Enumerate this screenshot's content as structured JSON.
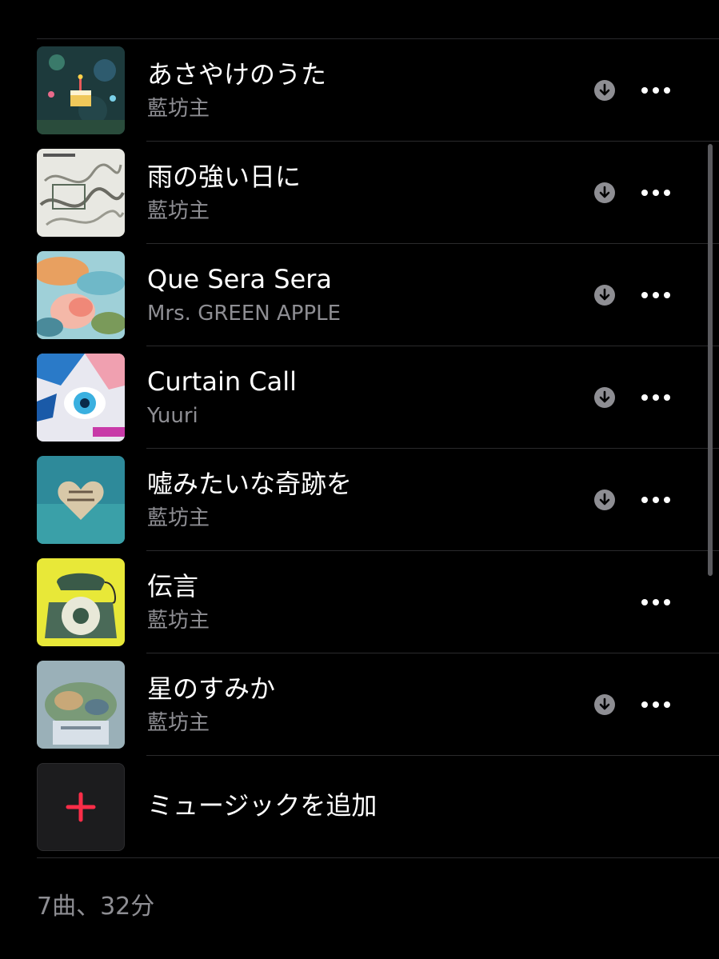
{
  "songs": [
    {
      "title": "あさやけのうた",
      "artist": "藍坊主",
      "downloadable": true
    },
    {
      "title": "雨の強い日に",
      "artist": "藍坊主",
      "downloadable": true
    },
    {
      "title": "Que Sera Sera",
      "artist": "Mrs. GREEN APPLE",
      "downloadable": true
    },
    {
      "title": "Curtain Call",
      "artist": "Yuuri",
      "downloadable": true
    },
    {
      "title": "嘘みたいな奇跡を",
      "artist": "藍坊主",
      "downloadable": true
    },
    {
      "title": "伝言",
      "artist": "藍坊主",
      "downloadable": false
    },
    {
      "title": "星のすみか",
      "artist": "藍坊主",
      "downloadable": true
    }
  ],
  "add_music": {
    "label": "ミュージックを追加",
    "icon": "plus-icon",
    "accent": "#fa2d48"
  },
  "summary": "7曲、32分",
  "icons": {
    "download": "download-icon",
    "more": "more-icon"
  }
}
